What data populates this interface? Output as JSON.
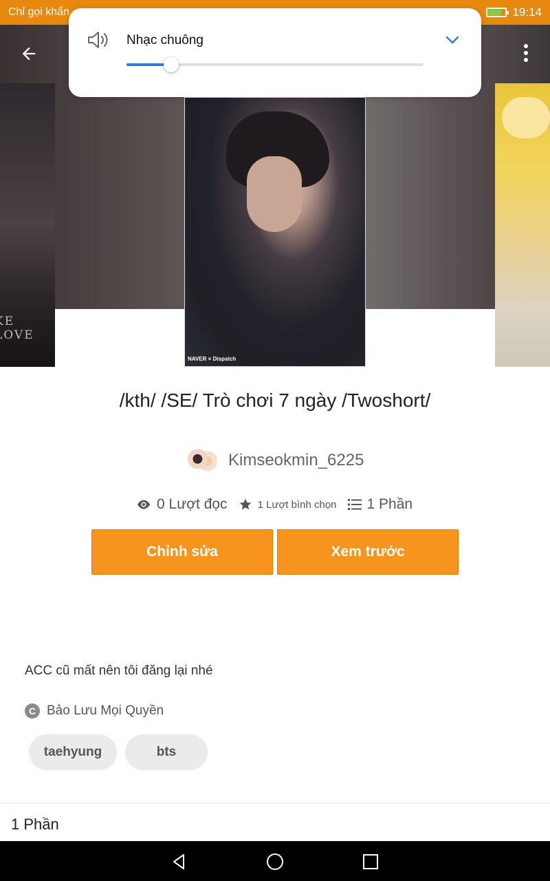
{
  "status_bar": {
    "carrier": "Chỉ gọi khẩn",
    "time": "19:14",
    "battery_level": 0.7
  },
  "header": {
    "back_icon": "arrow-left-icon",
    "more_icon": "more-vert-icon"
  },
  "volume_popup": {
    "label": "Nhạc chuông",
    "level": 0.15,
    "icon": "speaker-icon",
    "expand_icon": "chevron-down-icon",
    "accent": "#2f7bd9"
  },
  "cover": {
    "side_left_text": "KE LOVE",
    "watermark": "NAVER × Dispatch"
  },
  "story": {
    "title": "/kth/ /SE/ Trò chơi 7 ngày /Twoshort/",
    "author": "Kimseokmin_6225",
    "reads": "0 Lượt đọc",
    "votes": "1 Lượt bình chọn",
    "parts": "1 Phần",
    "edit_label": "Chỉnh sửa",
    "preview_label": "Xem trước",
    "description": "ACC cũ mất nên tôi đăng lại nhé",
    "copyright": "Bảo Lưu Mọi Quyền",
    "copyright_icon_text": "C",
    "tags": [
      "taehyung",
      "bts"
    ],
    "parts_footer": "1 Phần",
    "button_color": "#f7941d"
  },
  "nav_bar": {
    "back_icon": "nav-back-icon",
    "home_icon": "nav-home-icon",
    "recent_icon": "nav-recent-icon"
  }
}
